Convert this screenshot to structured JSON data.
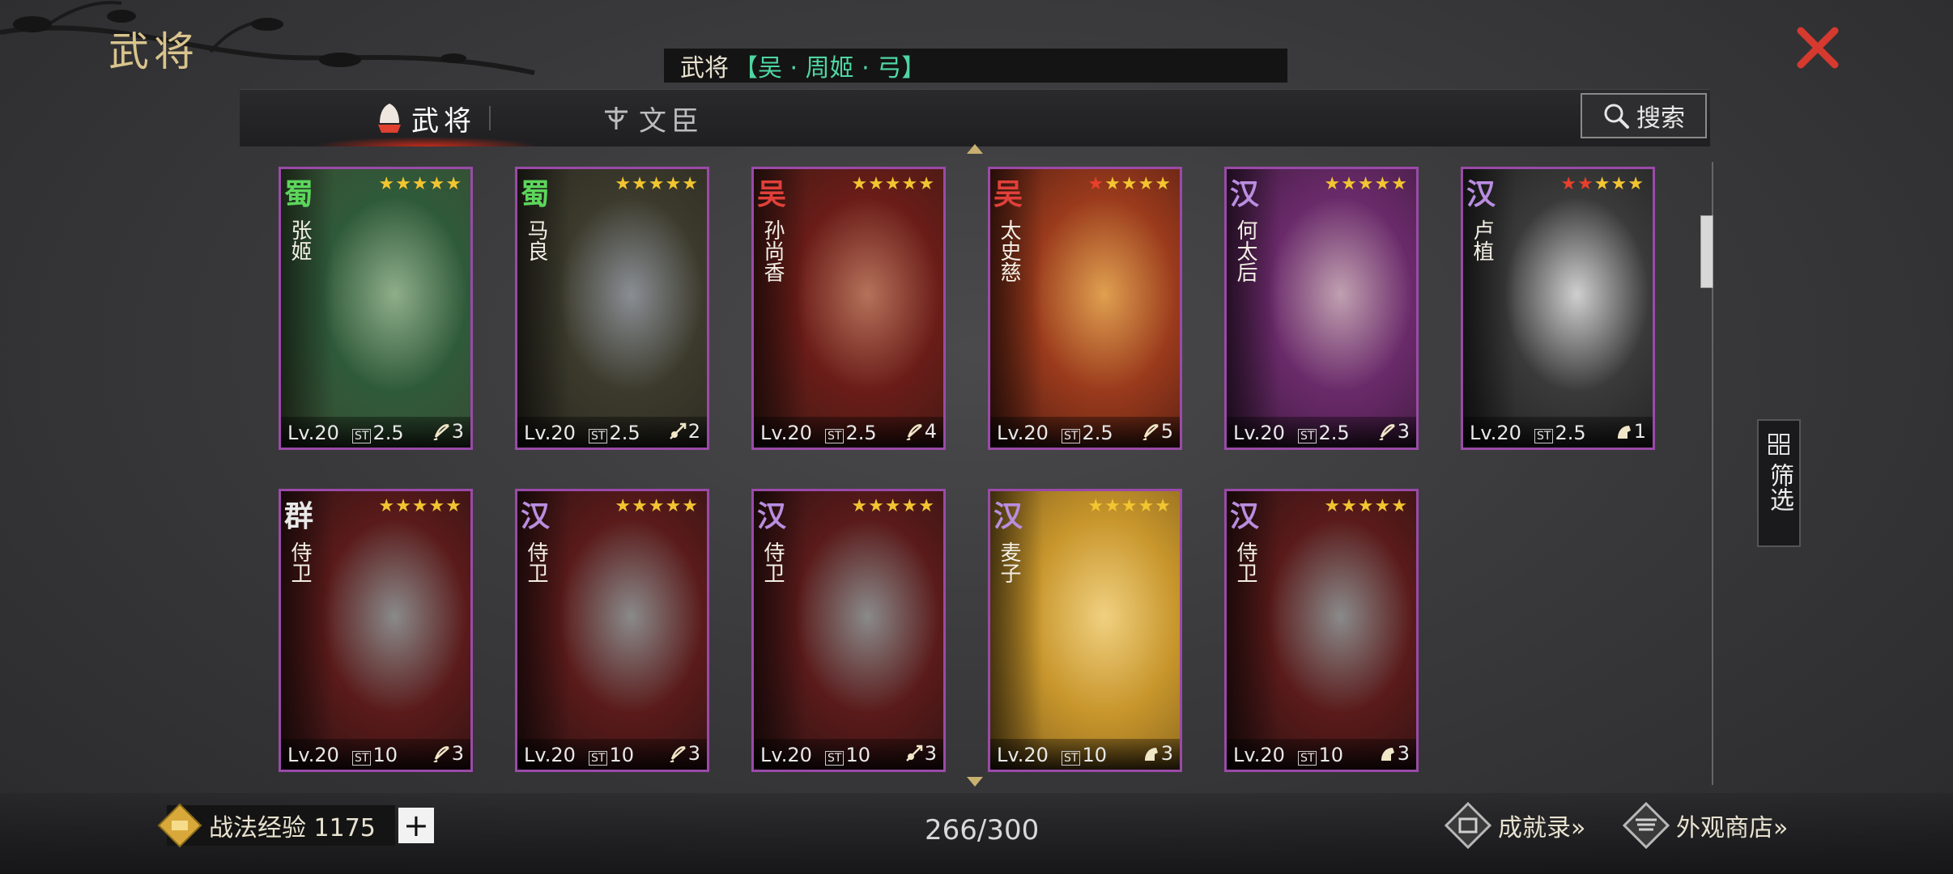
{
  "page": {
    "title": "武将"
  },
  "marquee": {
    "prefix": "武将",
    "highlight": "【吴 · 周姬 · 弓】"
  },
  "tabs": [
    {
      "label": "武将",
      "active": true
    },
    {
      "label": "文臣",
      "active": false
    }
  ],
  "search": {
    "label": "搜索"
  },
  "filter": {
    "label": "筛选"
  },
  "cards": [
    {
      "faction": "蜀",
      "faction_color": "#5cd65c",
      "name": "张姬",
      "stars": "★★★★★",
      "red_stars": 0,
      "level": "Lv.20",
      "cost": "2.5",
      "unit_icon": "bow-icon",
      "unit_count": "3",
      "palette": [
        "#2f5a3a",
        "#8fae8a",
        "#3a4a30"
      ]
    },
    {
      "faction": "蜀",
      "faction_color": "#5cd65c",
      "name": "马良",
      "stars": "★★★★★",
      "red_stars": 0,
      "level": "Lv.20",
      "cost": "2.5",
      "unit_icon": "spear-icon",
      "unit_count": "2",
      "palette": [
        "#3b3a2c",
        "#8a8e94",
        "#2a2820"
      ]
    },
    {
      "faction": "吴",
      "faction_color": "#e0403a",
      "name": "孙尚香",
      "stars": "★★★★★",
      "red_stars": 0,
      "level": "Lv.20",
      "cost": "2.5",
      "unit_icon": "bow-icon",
      "unit_count": "4",
      "palette": [
        "#6a1c18",
        "#b5725a",
        "#3a1a14"
      ]
    },
    {
      "faction": "吴",
      "faction_color": "#e0403a",
      "name": "太史慈",
      "stars": "★★★★★",
      "red_stars": 1,
      "level": "Lv.20",
      "cost": "2.5",
      "unit_icon": "bow-icon",
      "unit_count": "5",
      "palette": [
        "#9a3a1c",
        "#e0a050",
        "#4a1a12"
      ]
    },
    {
      "faction": "汉",
      "faction_color": "#b98de0",
      "name": "何太后",
      "stars": "★★★★★",
      "red_stars": 0,
      "level": "Lv.20",
      "cost": "2.5",
      "unit_icon": "bow-icon",
      "unit_count": "3",
      "palette": [
        "#6a2a6a",
        "#c0a0b0",
        "#3a1a3a"
      ]
    },
    {
      "faction": "汉",
      "faction_color": "#b98de0",
      "name": "卢植",
      "stars": "★★★★★",
      "red_stars": 2,
      "level": "Lv.20",
      "cost": "2.5",
      "unit_icon": "horse-icon",
      "unit_count": "1",
      "palette": [
        "#3a3a3a",
        "#cfcfcf",
        "#1e1e1e"
      ]
    },
    {
      "faction": "群",
      "faction_color": "#e8e8e8",
      "name": "侍卫",
      "stars": "★★★★★",
      "red_stars": 0,
      "level": "Lv.20",
      "cost": "10",
      "unit_icon": "bow-icon",
      "unit_count": "3",
      "palette": [
        "#5a1a1a",
        "#8a8a8a",
        "#2a1212"
      ]
    },
    {
      "faction": "汉",
      "faction_color": "#b98de0",
      "name": "侍卫",
      "stars": "★★★★★",
      "red_stars": 0,
      "level": "Lv.20",
      "cost": "10",
      "unit_icon": "bow-icon",
      "unit_count": "3",
      "palette": [
        "#5a1a1a",
        "#8a8a8a",
        "#2a1212"
      ]
    },
    {
      "faction": "汉",
      "faction_color": "#b98de0",
      "name": "侍卫",
      "stars": "★★★★★",
      "red_stars": 0,
      "level": "Lv.20",
      "cost": "10",
      "unit_icon": "spear-icon",
      "unit_count": "3",
      "palette": [
        "#5a1a1a",
        "#8a8a8a",
        "#2a1212"
      ]
    },
    {
      "faction": "汉",
      "faction_color": "#b98de0",
      "name": "麦子",
      "stars": "★★★★★",
      "red_stars": 0,
      "level": "Lv.20",
      "cost": "10",
      "unit_icon": "horse-icon",
      "unit_count": "3",
      "palette": [
        "#c8962c",
        "#f0d080",
        "#7a5a1a"
      ]
    },
    {
      "faction": "汉",
      "faction_color": "#b98de0",
      "name": "侍卫",
      "stars": "★★★★★",
      "red_stars": 0,
      "level": "Lv.20",
      "cost": "10",
      "unit_icon": "horse-icon",
      "unit_count": "3",
      "palette": [
        "#5a1a1a",
        "#8a8a8a",
        "#2a1212"
      ]
    }
  ],
  "footer": {
    "exp_label": "战法经验 1175",
    "plus": "+",
    "count": "266/300",
    "achievements": "成就录»",
    "shop": "外观商店»"
  }
}
